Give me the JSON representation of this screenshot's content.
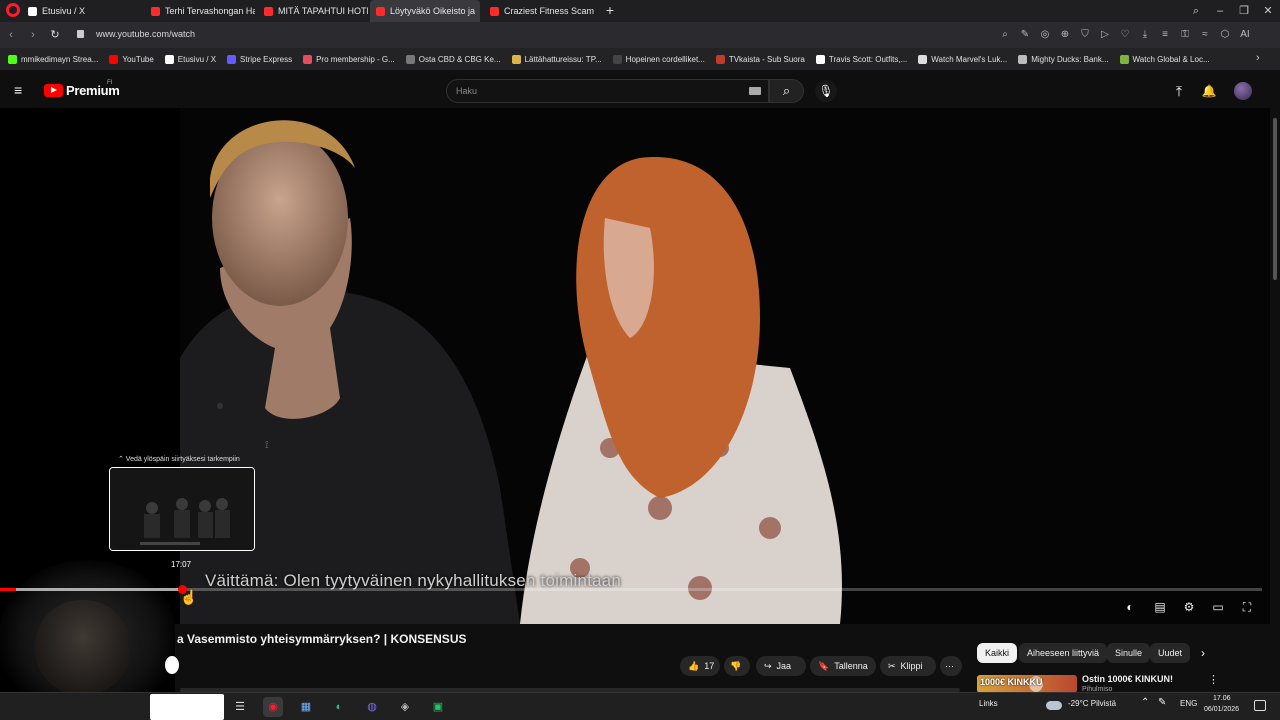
{
  "browser": {
    "tabs": [
      {
        "label": "Etusivu / X",
        "fav_color": "#ffffff",
        "active": false
      },
      {
        "label": "Terhi Tervashongan Haast",
        "fav_color": "#ff2a2a",
        "active": false
      },
      {
        "label": "MITÄ TAPAHTUI HOTELLIS",
        "fav_color": "#ff2a2a",
        "active": false
      },
      {
        "label": "Löytyväkö Oikeisto ja",
        "fav_color": "#ff2a2a",
        "active": true
      },
      {
        "label": "Craziest Fitness Scam I've",
        "fav_color": "#ff2a2a",
        "active": false
      }
    ],
    "new_tab_label": "+",
    "window_controls": [
      "⌕",
      "–",
      "❐",
      "✕"
    ],
    "nav": {
      "back": "‹",
      "forward": "›",
      "reload": "↻"
    },
    "url": "www.youtube.com/watch",
    "toolbar_icons": [
      "⌕",
      "✎",
      "◎",
      "⊕",
      "⛉",
      "▷",
      "♡",
      "⤓",
      "≡",
      "⚿",
      "≈",
      "⬡",
      "AI"
    ],
    "bookmarks": [
      {
        "label": "mmikedimayn Strea...",
        "color": "#53fc18"
      },
      {
        "label": "YouTube",
        "color": "#ff0000"
      },
      {
        "label": "Etusivu / X",
        "color": "#ffffff"
      },
      {
        "label": "Stripe Express",
        "color": "#635bff"
      },
      {
        "label": "Pro membership - G...",
        "color": "#e84a5f"
      },
      {
        "label": "Osta CBD & CBG Ke...",
        "color": "#777777"
      },
      {
        "label": "Lättähattureissu: TP...",
        "color": "#d9b44a"
      },
      {
        "label": "Hopeinen cordelliket...",
        "color": "#444444"
      },
      {
        "label": "TVkaista - Sub Suora",
        "color": "#c0392b"
      },
      {
        "label": "Travis Scott: Outfits,...",
        "color": "#ffffff"
      },
      {
        "label": "Watch Marvel's Luk...",
        "color": "#dddddd"
      },
      {
        "label": "Mighty Ducks: Bank...",
        "color": "#bbbbbb"
      },
      {
        "label": "Watch Global & Loc...",
        "color": "#7cb342"
      }
    ],
    "bookmarks_more": "›"
  },
  "youtube": {
    "logo_text": "Premium",
    "region": "FI",
    "menu_icon": "≡",
    "search_placeholder": "Haku",
    "search_icon": "⌕",
    "mic_icon": "🎙",
    "upload_icon": "⤒",
    "bell_icon": "🔔"
  },
  "player": {
    "subtitle": "Väittämä: Olen tyytyväinen nykyhallituksen toimintaan",
    "preview_hint": "⌃ Vedä ylöspäin siirtyäksesi tarkempiin",
    "preview_time": "17:07",
    "progress_played_fraction": 0.013,
    "controls": {
      "autoplay": "◐",
      "subtitles": "▤",
      "settings": "⚙",
      "theater": "▭",
      "fullscreen": "⛶"
    }
  },
  "video": {
    "title": "a Vasemmisto yhteisymmärryksen? | KONSENSUS",
    "like_count": "17",
    "like_icon": "👍",
    "dislike_icon": "👎",
    "share_label": "Jaa",
    "share_icon": "↪",
    "save_label": "Tallenna",
    "save_icon": "🔖",
    "clip_label": "Klippi",
    "clip_icon": "✂",
    "more_icon": "⋯"
  },
  "recommendations": {
    "chips": [
      "Kaikki",
      "Aiheeseen liittyviä",
      "Sinulle",
      "Uudet"
    ],
    "chips_next": "›",
    "first": {
      "thumb_text": "1000€ KINKKU",
      "title": "Ostin 1000€ KINKUN!",
      "channel": "Pihulmiso"
    },
    "more_icon": "⋮"
  },
  "taskbar": {
    "apps": [
      "☰",
      "◉",
      "▦",
      "◐",
      "◍",
      "◈",
      "▣"
    ],
    "links_label": "Links",
    "weather": "-29°C Pilvistä",
    "lang": "ENG",
    "time": "17.06",
    "date": "06/01/2026"
  }
}
